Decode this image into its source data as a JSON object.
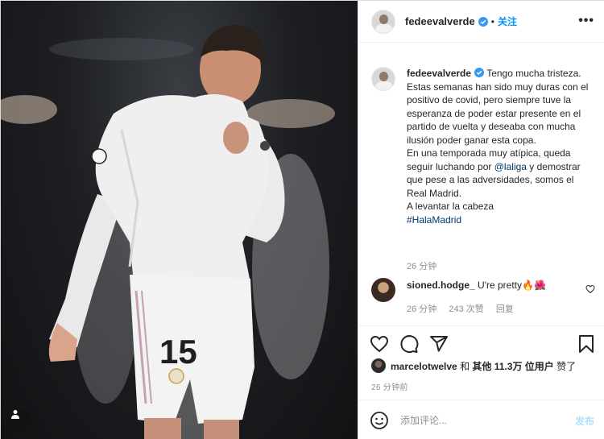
{
  "post": {
    "username": "fedeevalverde",
    "follow_label": "关注",
    "dot": "•",
    "more": "•••"
  },
  "caption": {
    "username": "fedeevalverde",
    "body": "Tengo mucha tristeza. Estas semanas han sido muy duras con el positivo de covid, pero siempre tuve la esperanza de poder estar presente en el partido de vuelta y deseaba con mucha ilusión poder ganar esta copa.",
    "line2_pre": "En una temporada muy atípica, queda seguir luchando por ",
    "mention": "@laliga",
    "line2_post": " y demostrar que pese a las adversidades, somos el Real Madrid.",
    "line3": "A levantar la cabeza",
    "hashtag": "#HalaMadrid",
    "time": "26 分钟"
  },
  "comment": {
    "username": "sioned.hodge_",
    "text": "U're pretty🔥🌺",
    "time": "26 分钟",
    "likes": "243 次赞",
    "reply": "回复"
  },
  "likes": {
    "user": "marcelotwelve",
    "and": "和",
    "others": "其他 11.3万 位用户",
    "liked": "赞了"
  },
  "post_time": "26 分钟前",
  "add_comment": {
    "placeholder": "添加评论...",
    "post_label": "发布"
  },
  "photo": {
    "jersey_number": "15"
  },
  "icons": {
    "verified": "verified-badge-icon",
    "heart": "heart-icon",
    "comment": "comment-icon",
    "share": "share-icon",
    "bookmark": "bookmark-icon",
    "emoji": "emoji-icon",
    "tag": "user-tag-icon"
  },
  "colors": {
    "accent": "#0095f6",
    "link": "#00376b",
    "muted": "#8e8e8e",
    "post_disabled": "#b2dffc"
  }
}
